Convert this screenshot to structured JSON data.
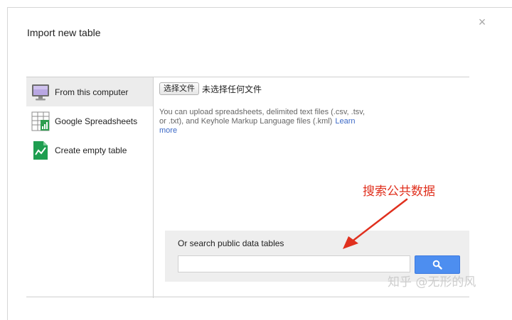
{
  "dialog": {
    "title": "Import new table",
    "close_glyph": "×"
  },
  "sidebar": {
    "items": [
      {
        "label": "From this computer",
        "icon": "monitor-icon",
        "selected": true
      },
      {
        "label": "Google Spreadsheets",
        "icon": "spreadsheet-icon",
        "selected": false
      },
      {
        "label": "Create empty table",
        "icon": "chart-file-icon",
        "selected": false
      }
    ]
  },
  "upload": {
    "button_label": "选择文件",
    "status": "未选择任何文件",
    "description": "You can upload spreadsheets, delimited text files (.csv, .tsv, or .txt), and Keyhole Markup Language files (.kml)",
    "learn_more": "Learn more"
  },
  "search": {
    "label": "Or search public data tables",
    "value": "",
    "button_icon": "search-icon",
    "button_color": "#4d8ef0"
  },
  "annotation": {
    "text": "搜索公共数据",
    "color": "#e0301e"
  },
  "watermark": {
    "text": "知乎 @无形的风"
  }
}
